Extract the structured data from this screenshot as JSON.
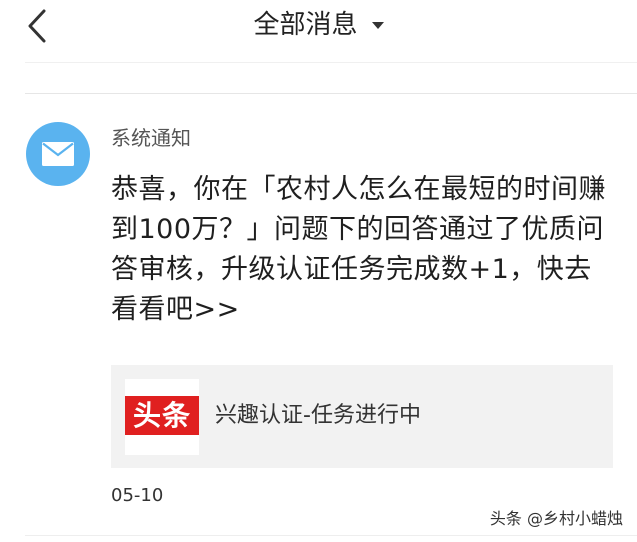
{
  "header": {
    "title": "全部消息"
  },
  "message": {
    "sender": "系统通知",
    "body": "恭喜，你在「农村人怎么在最短的时间赚到100万？」问题下的回答通过了优质问答审核，升级认证任务完成数+1，快去看看吧>>",
    "card": {
      "logo_text": "头条",
      "title": "兴趣认证-任务进行中"
    },
    "date": "05-10"
  },
  "watermark": "头条 @乡村小蜡烛",
  "colors": {
    "avatar": "#5ab3ef",
    "logo_red": "#e02020",
    "card_bg": "#f2f2f2"
  },
  "icons": {
    "back": "chevron-left-icon",
    "title_caret": "caret-down-icon",
    "avatar": "mail-icon"
  }
}
